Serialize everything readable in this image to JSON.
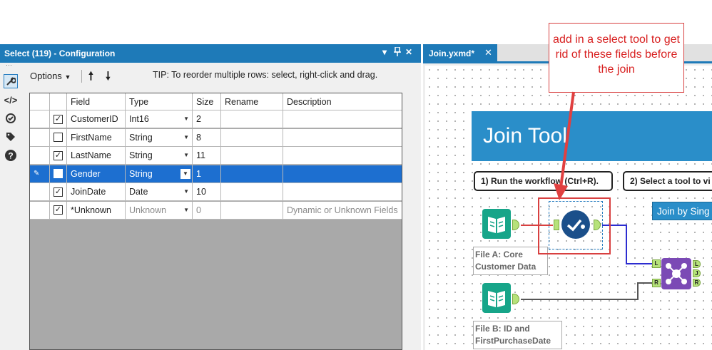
{
  "config_panel": {
    "title": "Select (119) - Configuration",
    "controls": {
      "dropdown": "▾",
      "pin": "📌",
      "close": "✕"
    },
    "toolbar": {
      "options_label": "Options",
      "tip": "TIP: To reorder multiple rows: select, right-click and drag."
    },
    "grid": {
      "columns": [
        "Field",
        "Type",
        "Size",
        "Rename",
        "Description"
      ],
      "rows": [
        {
          "checked": true,
          "field": "CustomerID",
          "type": "Int16",
          "size": "2",
          "rename": "",
          "description": "",
          "selected": false,
          "muted": false
        },
        {
          "checked": false,
          "field": "FirstName",
          "type": "String",
          "size": "8",
          "rename": "",
          "description": "",
          "selected": false,
          "muted": false
        },
        {
          "checked": true,
          "field": "LastName",
          "type": "String",
          "size": "11",
          "rename": "",
          "description": "",
          "selected": false,
          "muted": false
        },
        {
          "checked": false,
          "field": "Gender",
          "type": "String",
          "size": "1",
          "rename": "",
          "description": "",
          "selected": true,
          "muted": false
        },
        {
          "checked": true,
          "field": "JoinDate",
          "type": "Date",
          "size": "10",
          "rename": "",
          "description": "",
          "selected": false,
          "muted": false
        },
        {
          "checked": true,
          "field": "*Unknown",
          "type": "Unknown",
          "size": "0",
          "rename": "",
          "description": "Dynamic or Unknown Fields",
          "selected": false,
          "muted": true
        }
      ]
    }
  },
  "canvas_panel": {
    "tab_label": "Join.yxmd*",
    "banner_title": "Join Tool",
    "step1": "1) Run the workflow (Ctrl+R).",
    "step2": "2) Select a tool to vi",
    "join_by_button": "Join by Sing",
    "file_a_label": [
      "File A: Core",
      "Customer Data"
    ],
    "file_b_label": [
      "File B: ID and",
      "FirstPurchaseDate"
    ],
    "join_anchors": {
      "left": "L",
      "right": "R",
      "out_l": "L",
      "out_j": "J",
      "out_r": "R"
    }
  },
  "annotation": {
    "text": "add in a select tool to get rid of these fields before the join"
  },
  "colors": {
    "titlebar": "#1e7ab8",
    "selected_row": "#1d6fd0",
    "banner": "#2a8ec9",
    "annotation": "#d82020",
    "input_tool": "#17a589",
    "select_tool": "#1b4f8a",
    "join_tool": "#7b4ab5"
  },
  "icons": [
    "wrench-icon",
    "code-icon",
    "target-icon",
    "tag-icon",
    "help-icon",
    "arrow-up-icon",
    "arrow-down-icon",
    "book-icon",
    "check-circle-icon",
    "join-icon"
  ]
}
